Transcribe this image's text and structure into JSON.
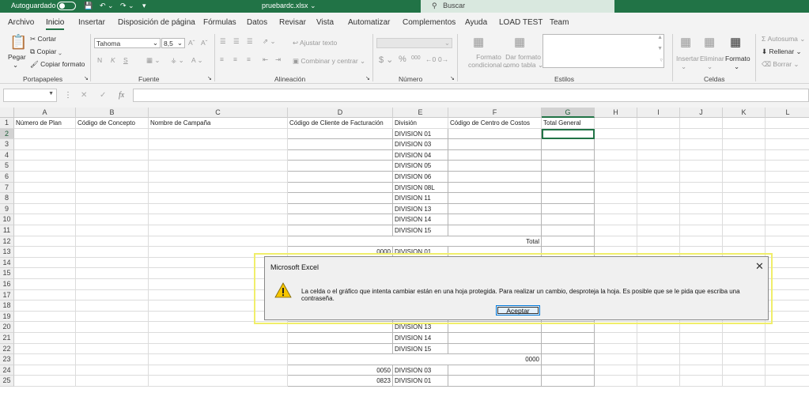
{
  "titlebar": {
    "autosave": "Autoguardado",
    "filename": "pruebardc.xlsx",
    "search_placeholder": "Buscar"
  },
  "tabs": [
    "Archivo",
    "Inicio",
    "Insertar",
    "Disposición de página",
    "Fórmulas",
    "Datos",
    "Revisar",
    "Vista",
    "Automatizar",
    "Complementos",
    "Ayuda",
    "LOAD TEST",
    "Team"
  ],
  "ribbon": {
    "clipboard": {
      "paste": "Pegar",
      "cut": "Cortar",
      "copy": "Copiar",
      "format_painter": "Copiar formato",
      "group": "Portapapeles"
    },
    "font": {
      "name": "Tahoma",
      "size": "8,5",
      "bold": "N",
      "italic": "K",
      "underline": "S",
      "group": "Fuente"
    },
    "alignment": {
      "wrap": "Ajustar texto",
      "merge": "Combinar y centrar",
      "group": "Alineación"
    },
    "number": {
      "currency": "$",
      "percent": "%",
      "thousands": "000",
      "group": "Número"
    },
    "styles": {
      "conditional": [
        "Formato",
        "condicional"
      ],
      "table": [
        "Dar formato",
        "como tabla"
      ],
      "group": "Estilos"
    },
    "cells": {
      "insert": "Insertar",
      "delete": "Eliminar",
      "format": "Formato",
      "group": "Celdas"
    },
    "editing": {
      "autosum": "Autosuma",
      "fill": "Rellenar",
      "clear": "Borrar"
    }
  },
  "formula_bar": {
    "name_box": "",
    "fx": "fx",
    "content": ""
  },
  "columns": [
    {
      "letter": "A",
      "header": "Número de Plan"
    },
    {
      "letter": "B",
      "header": "Código de Concepto"
    },
    {
      "letter": "C",
      "header": "Nombre de Campaña"
    },
    {
      "letter": "D",
      "header": "Código de Cliente de Facturación"
    },
    {
      "letter": "E",
      "header": "División"
    },
    {
      "letter": "F",
      "header": "Código de Centro de Costos"
    },
    {
      "letter": "G",
      "header": "Total General"
    },
    {
      "letter": "H",
      "header": ""
    },
    {
      "letter": "I",
      "header": ""
    },
    {
      "letter": "J",
      "header": ""
    },
    {
      "letter": "K",
      "header": ""
    },
    {
      "letter": "L",
      "header": ""
    }
  ],
  "rows": {
    "2": {
      "E": "DIVISION 01"
    },
    "3": {
      "E": "DIVISION 03"
    },
    "4": {
      "E": "DIVISION 04"
    },
    "5": {
      "E": "DIVISION 05"
    },
    "6": {
      "E": "DIVISION 06"
    },
    "7": {
      "E": "DIVISION 08L"
    },
    "8": {
      "E": "DIVISION 11"
    },
    "9": {
      "E": "DIVISION 13"
    },
    "10": {
      "E": "DIVISION 14"
    },
    "11": {
      "E": "DIVISION 15"
    },
    "12": {
      "DF": "Total"
    },
    "13": {
      "D": "0000",
      "E": "DIVISION 01"
    },
    "20": {
      "E": "DIVISION 13"
    },
    "21": {
      "E": "DIVISION 14"
    },
    "22": {
      "E": "DIVISION 15"
    },
    "23": {
      "DF": "0000"
    },
    "24": {
      "D": "0050",
      "E": "DIVISION 03"
    },
    "25": {
      "D": "0823",
      "E": "DIVISION 01"
    }
  },
  "dialog": {
    "title": "Microsoft Excel",
    "message": "La celda o el gráfico que intenta cambiar están en una hoja protegida. Para realizar un cambio, desproteja la hoja. Es posible que se le pida que escriba una contraseña.",
    "ok": "Aceptar"
  }
}
